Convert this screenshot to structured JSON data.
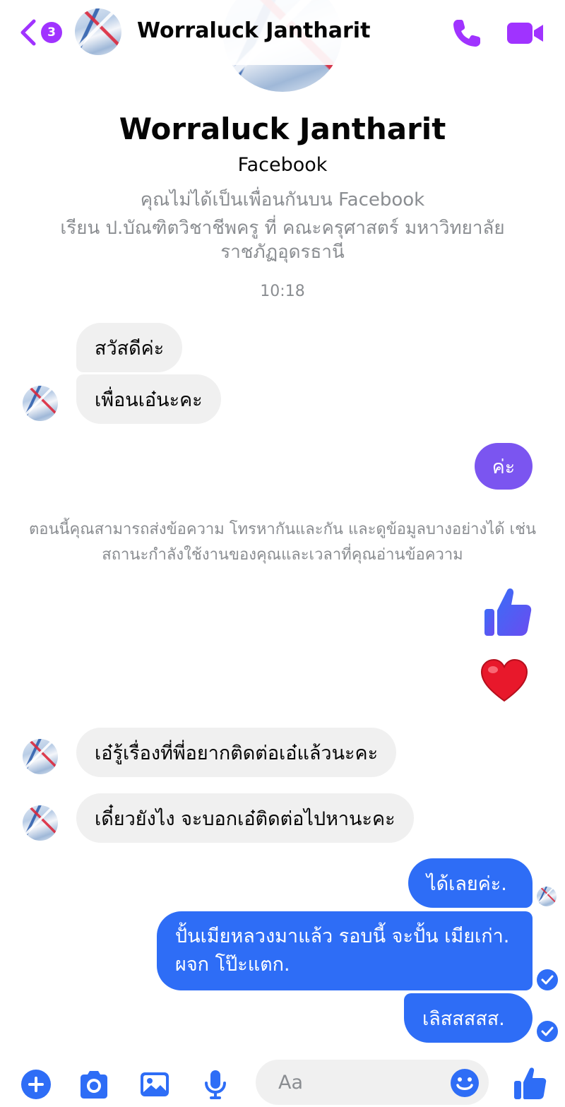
{
  "colors": {
    "accent": "#a033ff",
    "outgoing_bubble": "#2e6df6",
    "incoming_bubble": "#f0f0f0",
    "secondary_text": "#8a8d91",
    "heart": "#e8182b"
  },
  "header": {
    "back_badge": "3",
    "contact_name": "Worraluck Jantharit",
    "icons": [
      "chevron-left-icon",
      "phone-icon",
      "video-camera-icon"
    ]
  },
  "profile": {
    "name": "Worraluck Jantharit",
    "platform": "Facebook",
    "friend_status": "คุณไม่ได้เป็นเพื่อนกันบน Facebook",
    "education": "เรียน ป.บัณฑิตวิชาชีพครู ที่ คณะครุศาสตร์ มหาวิทยาลัยราชภัฏอุดรธานี"
  },
  "thread": {
    "timestamp": "10:18",
    "incoming_1": "สวัสดีค่ะ",
    "incoming_2": "เพื่อนเอ๋นะคะ",
    "outgoing_1": "ค่ะ",
    "system_note": "ตอนนี้คุณสามารถส่งข้อความ โทรหากันและกัน และดูข้อมูลบางอย่างได้ เช่น สถานะกำลังใช้งานของคุณและเวลาที่คุณอ่านข้อความ",
    "outgoing_reactions": [
      "thumbs-up-icon",
      "heart-icon"
    ],
    "incoming_3": "เอ๋รู้เรื่องที่พี่อยากติดต่อเอ๋แล้วนะคะ",
    "incoming_4": "เดี๋ยวยังไง จะบอกเอ๋ติดต่อไปหานะคะ",
    "outgoing_2": "ได้เลยค่ะ.",
    "outgoing_3": "ปั้นเมียหลวงมาแล้ว รอบนี้ จะปั้น เมียเก่า. ผจก โป๊ะแตก.",
    "outgoing_4": "เลิสสสสส."
  },
  "composer": {
    "placeholder": "Aa",
    "icons": [
      "plus-circle-icon",
      "camera-icon",
      "image-icon",
      "microphone-icon",
      "smiley-icon",
      "thumbs-up-icon"
    ]
  }
}
